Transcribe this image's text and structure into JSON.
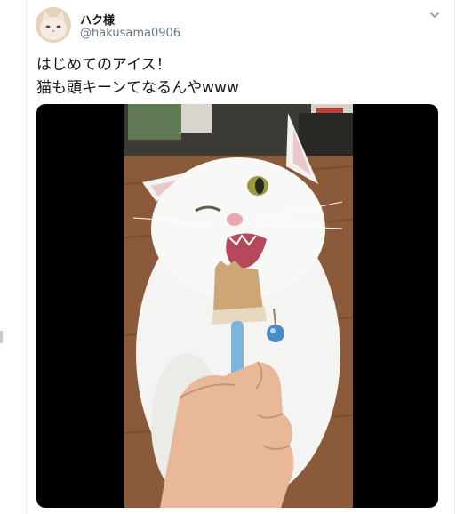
{
  "tweet": {
    "display_name": "ハク様",
    "handle": "@hakusama0906",
    "text_line1": "はじめてのアイス！",
    "text_line2": "猫も頭キーンてなるんやwww"
  },
  "icons": {
    "menu": "chevron-down-icon"
  },
  "colors": {
    "text": "#14171a",
    "secondary": "#657786",
    "border": "#e6ecf0",
    "media_bg": "#000000"
  }
}
